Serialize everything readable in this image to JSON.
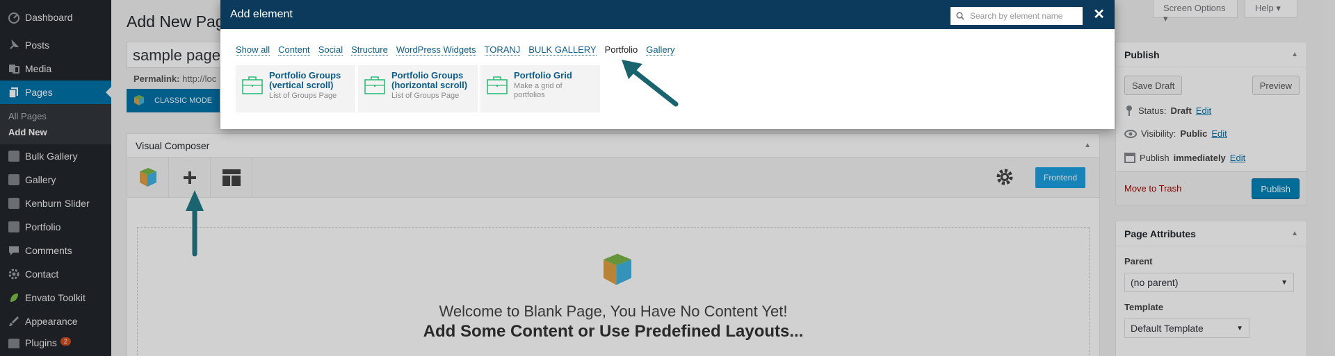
{
  "sidebar": {
    "items": [
      {
        "label": "Dashboard",
        "icon": "dashboard-icon"
      },
      {
        "label": "Posts",
        "icon": "pushpin-icon"
      },
      {
        "label": "Media",
        "icon": "media-icon"
      },
      {
        "label": "Pages",
        "icon": "pages-icon"
      }
    ],
    "sub": [
      "All Pages",
      "Add New"
    ],
    "items2": [
      {
        "label": "Bulk Gallery",
        "icon": "plugin-square-icon"
      },
      {
        "label": "Gallery",
        "icon": "plugin-square-icon"
      },
      {
        "label": "Kenburn Slider",
        "icon": "plugin-square-icon"
      },
      {
        "label": "Portfolio",
        "icon": "plugin-square-icon"
      },
      {
        "label": "Comments",
        "icon": "comment-icon"
      },
      {
        "label": "Contact",
        "icon": "gear-icon"
      },
      {
        "label": "Envato Toolkit",
        "icon": "leaf-icon"
      },
      {
        "label": "Appearance",
        "icon": "brush-icon"
      }
    ],
    "plugins_label": "Plugins",
    "plugins_count": "2"
  },
  "header": {
    "screen_options": "Screen Options ▾",
    "help": "Help ▾",
    "page_title": "Add New Page",
    "title_value": "sample page",
    "permalink_label": "Permalink:",
    "permalink_value": "http://loc",
    "classic_mode": "CLASSIC MODE"
  },
  "vc": {
    "title": "Visual Composer",
    "frontend": "Frontend",
    "welcome": "Welcome to Blank Page, You Have No Content Yet!",
    "add_content": "Add Some Content or Use Predefined Layouts..."
  },
  "publish": {
    "title": "Publish",
    "save_draft": "Save Draft",
    "preview": "Preview",
    "status_label": "Status:",
    "status_value": "Draft",
    "visibility_label": "Visibility:",
    "visibility_value": "Public",
    "publish_label": "Publish",
    "publish_value": "immediately",
    "edit": "Edit",
    "trash": "Move to Trash",
    "publish_btn": "Publish"
  },
  "attributes": {
    "title": "Page Attributes",
    "parent_label": "Parent",
    "parent_value": "(no parent)",
    "template_label": "Template",
    "template_value": "Default Template"
  },
  "modal": {
    "title": "Add element",
    "search_placeholder": "Search by element name",
    "close": "✕",
    "tabs": [
      "Show all",
      "Content",
      "Social",
      "Structure",
      "WordPress Widgets",
      "TORANJ",
      "BULK GALLERY",
      "Portfolio",
      "Gallery"
    ],
    "active_tab": "Portfolio",
    "cards": [
      {
        "title": "Portfolio Groups (vertical scroll)",
        "desc": "List of Groups Page"
      },
      {
        "title": "Portfolio Groups (horizontal scroll)",
        "desc": "List of Groups Page"
      },
      {
        "title": "Portfolio Grid",
        "desc": "Make a grid of portfolios"
      }
    ]
  },
  "colors": {
    "sidebar_bg": "#23282d",
    "accent": "#0073aa",
    "modal_header": "#0b3a5c",
    "card_icon": "#2ebd7a",
    "tutorial_arrow": "#1a6470"
  }
}
